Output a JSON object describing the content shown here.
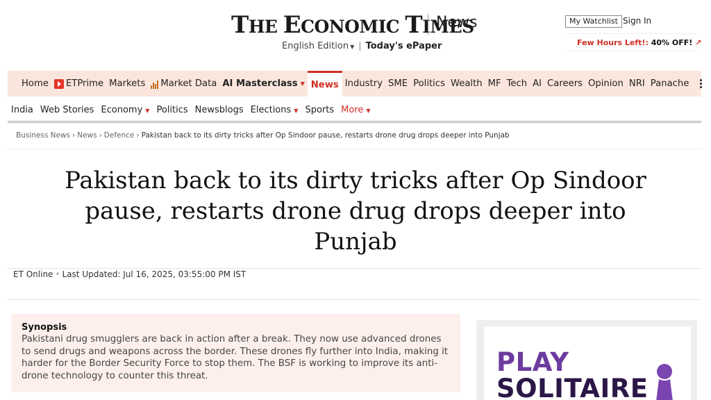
{
  "header": {
    "logo": "The Economic Times",
    "section": "News",
    "edition": "English Edition",
    "epaper": "Today's ePaper",
    "watchlist": "My Watchlist",
    "signin": "Sign In",
    "promo_red": "Few Hours Left!:",
    "promo_offer": "40% OFF!",
    "promo_arrow": "↗"
  },
  "nav_primary": {
    "home": "Home",
    "etprime": "ETPrime",
    "markets": "Markets",
    "market_data": "Market Data",
    "ai_masterclass": "AI Masterclass",
    "news": "News",
    "industry": "Industry",
    "sme": "SME",
    "politics": "Politics",
    "wealth": "Wealth",
    "mf": "MF",
    "tech": "Tech",
    "ai": "AI",
    "careers": "Careers",
    "opinion": "Opinion",
    "nri": "NRI",
    "panache": "Panache"
  },
  "nav_secondary": {
    "items": [
      "India",
      "Web Stories",
      "Economy",
      "Politics",
      "Newsblogs",
      "Elections",
      "Sports",
      "More"
    ]
  },
  "breadcrumb": {
    "items": [
      "Business News",
      "News",
      "Defence"
    ],
    "current": "Pakistan back to its dirty tricks after Op Sindoor pause, restarts drone drug drops deeper into Punjab"
  },
  "article": {
    "headline": "Pakistan back to its dirty tricks after Op Sindoor pause, restarts drone drug drops deeper into Punjab",
    "author": "ET Online",
    "updated": "Last Updated: Jul 16, 2025, 03:55:00 PM IST"
  },
  "synopsis": {
    "title": "Synopsis",
    "text": "Pakistani drug smugglers are back in action after a break. They now use advanced drones to send drugs and weapons across the border. These drones fly further into India, making it harder for the Border Security Force to stop them. The BSF is working to improve its anti-drone technology to counter this threat."
  },
  "ad": {
    "line1": "PLAY",
    "line2": "SOLITAIRE"
  },
  "colors": {
    "brand_red": "#d02f26",
    "nav_bg": "#fbe6dd",
    "synopsis_bg": "#fdf0ec",
    "ad_purple": "#6c3b9e"
  }
}
